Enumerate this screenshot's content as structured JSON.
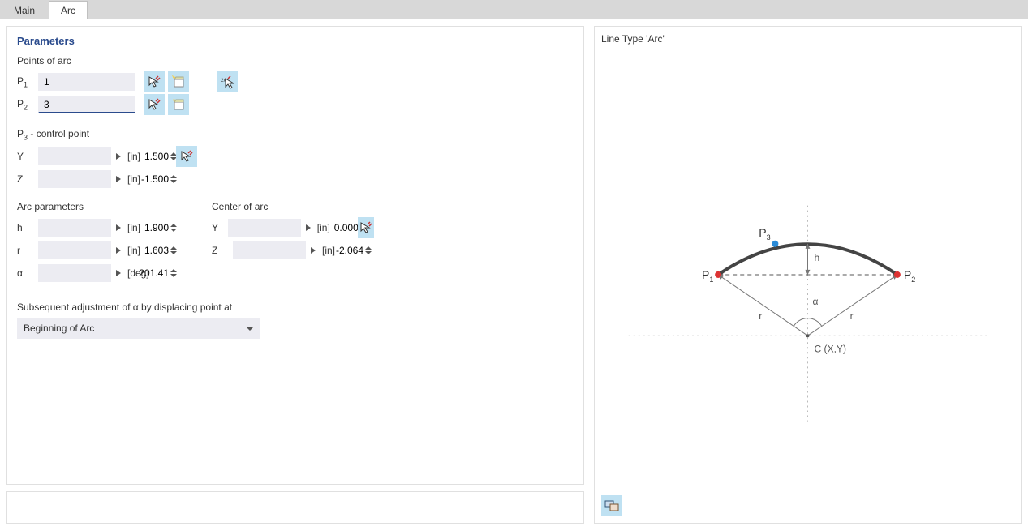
{
  "tabs": {
    "main": "Main",
    "arc": "Arc"
  },
  "left": {
    "title": "Parameters",
    "points_label": "Points of arc",
    "p1_label": "P",
    "p1_sub": "1",
    "p1_val": "1",
    "p2_label": "P",
    "p2_sub": "2",
    "p2_val": "3",
    "control_label_pre": "P",
    "control_sub": "3",
    "control_label_post": " - control point",
    "y_label": "Y",
    "y_val": "1.500",
    "y_unit": "[in]",
    "z_label": "Z",
    "z_val": "-1.500",
    "z_unit": "[in]",
    "arc_params_label": "Arc parameters",
    "h_label": "h",
    "h_val": "1.900",
    "h_unit": "[in]",
    "r_label": "r",
    "r_val": "1.603",
    "r_unit": "[in]",
    "a_label": "α",
    "a_val": "201.41",
    "a_unit": "[deg]",
    "center_label": "Center of arc",
    "cy_label": "Y",
    "cy_val": "0.000",
    "cy_unit": "[in]",
    "cz_label": "Z",
    "cz_val": "-2.064",
    "cz_unit": "[in]",
    "adjust_label": "Subsequent adjustment of α by displacing point at",
    "adjust_value": "Beginning of Arc"
  },
  "right": {
    "title": "Line Type 'Arc'",
    "diagram": {
      "p1": "P",
      "p1_sub": "1",
      "p2": "P",
      "p2_sub": "2",
      "p3": "P",
      "p3_sub": "3",
      "h": "h",
      "r": "r",
      "alpha": "α",
      "center": "C (X,Y)"
    }
  }
}
